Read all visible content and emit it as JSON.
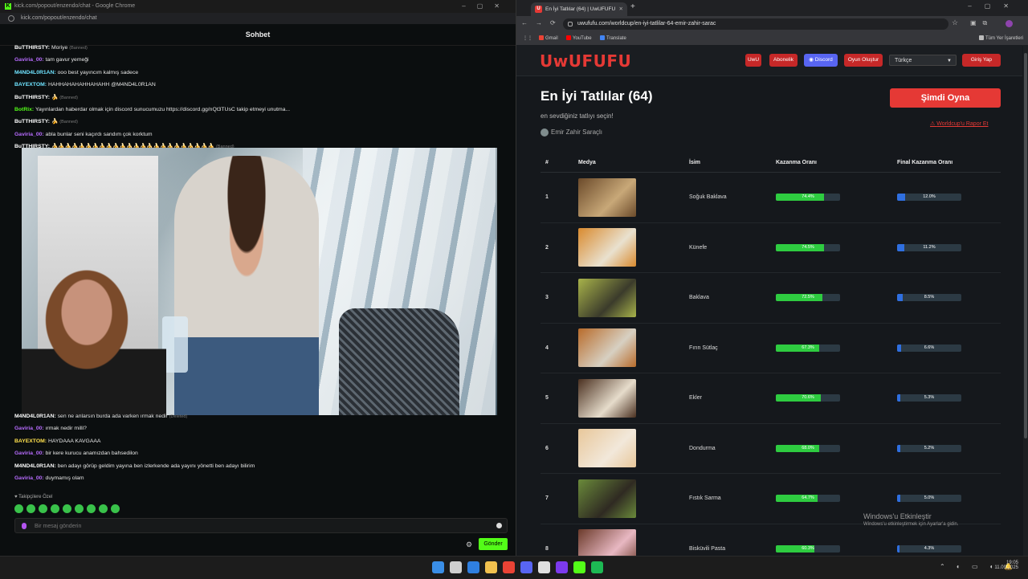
{
  "left_window": {
    "title": "kick.com/popout/enzendo/chat - Google Chrome",
    "url": "kick.com/popout/enzendo/chat",
    "header": "Sohbet",
    "messages": [
      {
        "user": "BuTTHIRSTY:",
        "text": "Moriye",
        "note": "(Banned)",
        "color": "#ffffff"
      },
      {
        "user": "Gaviria_00:",
        "text": "tam gavur yemeği",
        "note": "",
        "color": "#b86cff"
      },
      {
        "user": "M4ND4L0R1AN:",
        "text": "ooo best yayıncım kalmış sadece",
        "note": "",
        "color": "#6fe3ff"
      },
      {
        "user": "BAYEXTOM:",
        "text": "HAHHAHAHAHHAHAHH @M4ND4L0R1AN",
        "note": "",
        "color": "#6fe3ff"
      },
      {
        "user": "BuTTHIRSTY:",
        "text": "🍌",
        "note": "(Banned)",
        "color": "#ffffff"
      },
      {
        "user": "BotRix:",
        "text": "Yayınlardan haberdar olmak için discord sunucumuzu https://discord.gg/nQt3TUsC takip etmeyi unutma...",
        "note": "",
        "color": "#53fc18"
      },
      {
        "user": "BuTTHIRSTY:",
        "text": "🍌",
        "note": "(Banned)",
        "color": "#ffffff"
      },
      {
        "user": "Gaviria_00:",
        "text": "abla bunlar seni kaçırdı sandım çok korktum",
        "note": "",
        "color": "#b86cff"
      },
      {
        "user": "BuTTHIRSTY:",
        "text": "🍌🍌🍌🍌🍌🍌🍌🍌🍌🍌🍌🍌🍌🍌🍌🍌🍌🍌🍌🍌🍌🍌🍌🍌",
        "note": "(Banned)",
        "color": "#ffffff"
      }
    ],
    "messages_bottom": [
      {
        "user": "M4ND4L0R1AN:",
        "text": "sen ne anlarsın burda ada varken ırmak nedir",
        "note": "(Deleted)",
        "color": "#ffffff"
      },
      {
        "user": "Gaviria_00:",
        "text": "ırmak nedir milli?",
        "note": "",
        "color": "#b86cff"
      },
      {
        "user": "BAYEXTOM:",
        "text": "HAYDAAA KAVGAAA",
        "note": "",
        "color": "#ffe14d"
      },
      {
        "user": "Gaviria_00:",
        "text": "bir kere kurucu anamızdan bahsedilon",
        "note": "",
        "color": "#b86cff"
      },
      {
        "user": "M4ND4L0R1AN:",
        "text": "ben adayı görüp geldim yayına ben izlerkende ada yayını yönetti ben adayı bilirim",
        "note": "",
        "color": "#ffffff"
      },
      {
        "user": "Gaviria_00:",
        "text": "duymamış olam",
        "note": "",
        "color": "#b86cff"
      }
    ],
    "follower_label": "♥ Takipçilere Özel",
    "input_placeholder": "Bir mesaj gönderin",
    "send_label": "Gönder"
  },
  "right_window": {
    "tab_title": "En İyi Tatlılar (64) | UwUFUFU",
    "url": "uwufufu.com/worldcup/en-iyi-tatlilar-64-emir-zahir-sarac",
    "bookmarks": [
      "Gmail",
      "YouTube",
      "Translate",
      "Tüm Yer İşaretleri"
    ],
    "site": {
      "logo": "UwUFUFU",
      "nav": [
        "UwU",
        "Abonelik",
        "Discord",
        "Oyun Oluştur"
      ],
      "language": "Türkçe",
      "login": "Giriş Yap",
      "title": "En İyi Tatlılar (64)",
      "subtitle": "en sevdiğiniz tatlıyı seçin!",
      "author": "Emir Zahir Saraçlı",
      "play_button": "Şimdi Oyna",
      "report_link": "Worldcup'u Rapor Et",
      "columns": [
        "#",
        "Medya",
        "İsim",
        "Kazanma Oranı",
        "Final Kazanma Oranı"
      ],
      "rows": [
        {
          "rank": "1",
          "name": "Soğuk Baklava",
          "win": "74.4%",
          "win_value": 74.4,
          "final": "12.0%",
          "final_value": 12.0,
          "img_colors": [
            "#6b4a2a",
            "#c8a878"
          ]
        },
        {
          "rank": "2",
          "name": "Künefe",
          "win": "74.5%",
          "win_value": 74.5,
          "final": "11.2%",
          "final_value": 11.2,
          "img_colors": [
            "#d98a2e",
            "#e9e1cf"
          ]
        },
        {
          "rank": "3",
          "name": "Baklava",
          "win": "72.5%",
          "win_value": 72.5,
          "final": "8.5%",
          "final_value": 8.5,
          "img_colors": [
            "#a8b34a",
            "#3b3b2b"
          ]
        },
        {
          "rank": "4",
          "name": "Fırın Sütlaç",
          "win": "67.3%",
          "win_value": 67.3,
          "final": "6.6%",
          "final_value": 6.6,
          "img_colors": [
            "#b86b2a",
            "#d7d0c2"
          ]
        },
        {
          "rank": "5",
          "name": "Ekler",
          "win": "70.6%",
          "win_value": 70.6,
          "final": "5.3%",
          "final_value": 5.3,
          "img_colors": [
            "#4a3020",
            "#e6dccb"
          ]
        },
        {
          "rank": "6",
          "name": "Dondurma",
          "win": "68.0%",
          "win_value": 68.0,
          "final": "5.2%",
          "final_value": 5.2,
          "img_colors": [
            "#e8c79a",
            "#f2e8da"
          ]
        },
        {
          "rank": "7",
          "name": "Fıstık Sarma",
          "win": "64.7%",
          "win_value": 64.7,
          "final": "5.0%",
          "final_value": 5.0,
          "img_colors": [
            "#6a8a3a",
            "#2f2a22"
          ]
        },
        {
          "rank": "8",
          "name": "Bisküvili Pasta",
          "win": "60.3%",
          "win_value": 60.3,
          "final": "4.3%",
          "final_value": 4.3,
          "img_colors": [
            "#6b3a2a",
            "#e8b8c2"
          ]
        }
      ],
      "activate_title": "Windows'u Etkinleştir",
      "activate_text": "Windows'u etkinleştirmek için Ayarlar'a gidin."
    }
  },
  "taskbar": {
    "time": "19:05",
    "date": "11.09.2025",
    "app_colors": [
      "#3a8ee6",
      "#cfcfcf",
      "#2f7fe0",
      "#f2c14e",
      "#ea4335",
      "#5865f2",
      "#e0e0e0",
      "#7c3aed",
      "#53fc18",
      "#1db954"
    ]
  }
}
